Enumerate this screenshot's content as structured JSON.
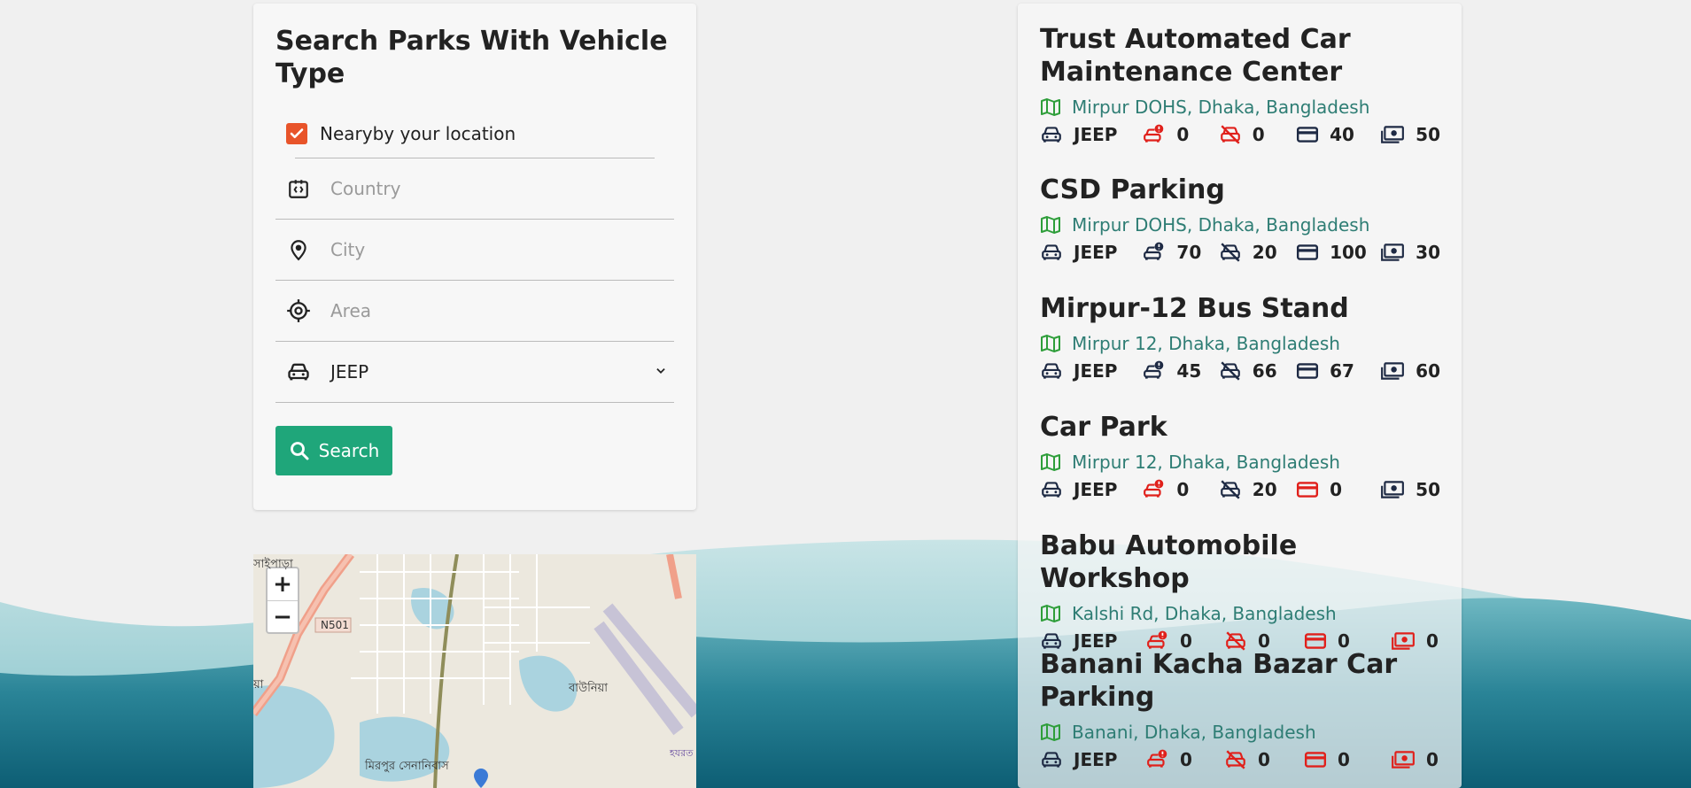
{
  "search": {
    "title": "Search Parks With Vehicle Type",
    "nearby_label": "Nearyby your location",
    "country_placeholder": "Country",
    "city_placeholder": "City",
    "area_placeholder": "Area",
    "vehicle_selected": "JEEP",
    "search_label": "Search"
  },
  "map": {
    "zoom_in": "+",
    "zoom_out": "−",
    "labels": [
      "সাইপাড়া",
      "N501",
      "য়া",
      "বাউনিয়া",
      "মিরপুর সেনানিবাস",
      "হযরত"
    ]
  },
  "parks": [
    {
      "name": "Trust Automated Car Maintenance Center",
      "address": "Mirpur DOHS, Dhaka, Bangladesh",
      "vehicle": "JEEP",
      "v1": "0",
      "v2": "0",
      "v3": "40",
      "v4": "50",
      "v1_alert": true,
      "v2_alert": true,
      "v3_alert": false,
      "v4_alert": false
    },
    {
      "name": "CSD Parking",
      "address": "Mirpur DOHS, Dhaka, Bangladesh",
      "vehicle": "JEEP",
      "v1": "70",
      "v2": "20",
      "v3": "100",
      "v4": "30",
      "v1_alert": false,
      "v2_alert": false,
      "v3_alert": false,
      "v4_alert": false
    },
    {
      "name": "Mirpur-12 Bus Stand",
      "address": "Mirpur 12, Dhaka, Bangladesh",
      "vehicle": "JEEP",
      "v1": "45",
      "v2": "66",
      "v3": "67",
      "v4": "60",
      "v1_alert": false,
      "v2_alert": false,
      "v3_alert": false,
      "v4_alert": false
    },
    {
      "name": "Car Park",
      "address": "Mirpur 12, Dhaka, Bangladesh",
      "vehicle": "JEEP",
      "v1": "0",
      "v2": "20",
      "v3": "0",
      "v4": "50",
      "v1_alert": true,
      "v2_alert": false,
      "v3_alert": true,
      "v4_alert": false
    },
    {
      "name": "Babu Automobile Workshop",
      "address": "Kalshi Rd, Dhaka, Bangladesh",
      "vehicle": "JEEP",
      "v1": "0",
      "v2": "0",
      "v3": "0",
      "v4": "0",
      "v1_alert": true,
      "v2_alert": true,
      "v3_alert": true,
      "v4_alert": true
    },
    {
      "name": "Banani Kacha Bazar Car Parking",
      "address": "Banani, Dhaka, Bangladesh",
      "vehicle": "JEEP",
      "v1": "0",
      "v2": "0",
      "v3": "0",
      "v4": "0",
      "v1_alert": true,
      "v2_alert": true,
      "v3_alert": true,
      "v4_alert": true
    }
  ],
  "colors": {
    "accent": "#1fa67a",
    "alert": "#e0201b",
    "icon": "#1e2a44",
    "address": "#2e7d74",
    "map_icon": "#2e9e3a"
  }
}
